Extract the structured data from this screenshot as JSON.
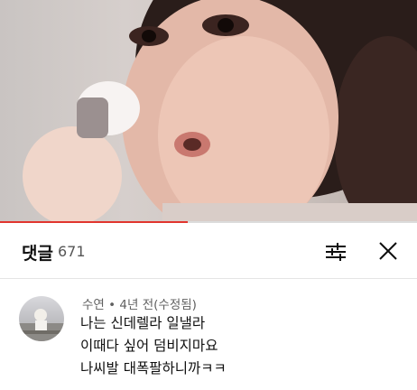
{
  "video": {
    "progress_fraction": 0.45
  },
  "comments_panel": {
    "title": "댓글",
    "count": "671",
    "icons": {
      "sort": "sort-filter-icon",
      "close": "close-icon"
    }
  },
  "comment": {
    "author": "수연",
    "separator": "•",
    "time": "4년 전(수정됨)",
    "lines": [
      "나는 신데렐라 일낼라",
      "이때다 싶어 덤비지마요",
      "나씨발 대폭팔하니까ㅋㅋ"
    ]
  },
  "colors": {
    "progress": "#e1352e",
    "meta_text": "#606060"
  }
}
